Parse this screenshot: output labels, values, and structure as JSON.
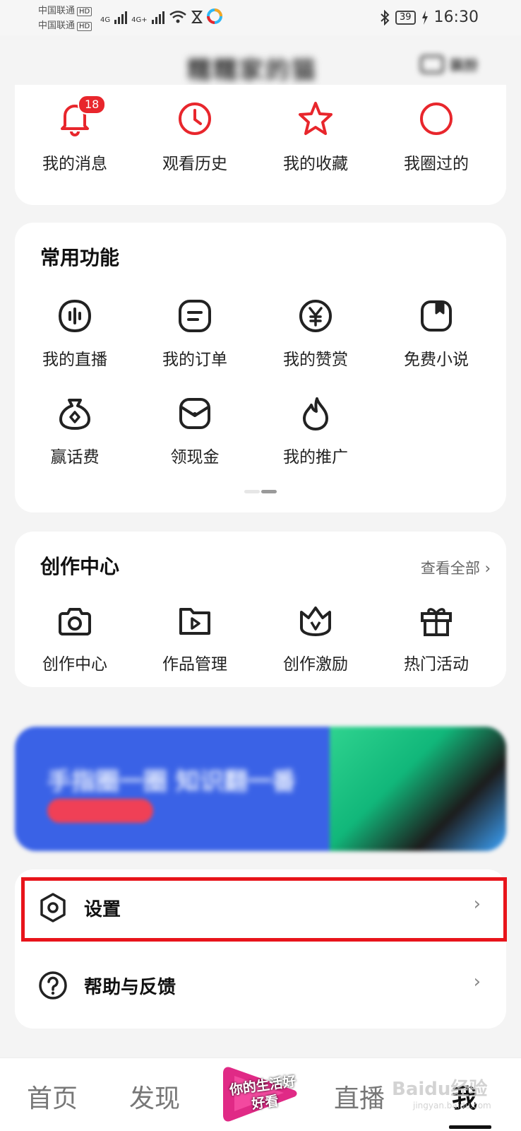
{
  "status_bar": {
    "carrier_1": "中国联通",
    "carrier_2": "中国联通",
    "hd_badge": "HD",
    "network_1": "4G",
    "network_2": "4G+",
    "battery": "39",
    "time": "16:30"
  },
  "header": {
    "username": "糯糯家的猫",
    "button_label": "装扮"
  },
  "quick_access": [
    {
      "label": "我的消息",
      "icon": "bell-icon",
      "badge": "18"
    },
    {
      "label": "观看历史",
      "icon": "clock-icon"
    },
    {
      "label": "我的收藏",
      "icon": "star-icon"
    },
    {
      "label": "我圈过的",
      "icon": "circle-icon"
    }
  ],
  "common_functions": {
    "title": "常用功能",
    "items": [
      {
        "label": "我的直播",
        "icon": "live-icon"
      },
      {
        "label": "我的订单",
        "icon": "order-icon"
      },
      {
        "label": "我的赞赏",
        "icon": "yuan-icon"
      },
      {
        "label": "免费小说",
        "icon": "book-icon"
      },
      {
        "label": "赢话费",
        "icon": "money-bag-icon"
      },
      {
        "label": "领现金",
        "icon": "red-envelope-icon"
      },
      {
        "label": "我的推广",
        "icon": "flame-icon"
      }
    ]
  },
  "creation_center": {
    "title": "创作中心",
    "view_all": "查看全部",
    "items": [
      {
        "label": "创作中心",
        "icon": "camera-icon"
      },
      {
        "label": "作品管理",
        "icon": "video-folder-icon"
      },
      {
        "label": "创作激励",
        "icon": "crown-icon"
      },
      {
        "label": "热门活动",
        "icon": "gift-icon"
      }
    ]
  },
  "banner": {
    "text": "手指圈一圈 知识翻一番"
  },
  "menu": [
    {
      "label": "设置",
      "icon": "settings-icon"
    },
    {
      "label": "帮助与反馈",
      "icon": "help-icon"
    }
  ],
  "tab_bar": {
    "tabs": [
      "首页",
      "发现",
      "直播",
      "我"
    ],
    "center_logo_text": "你的生活好好看",
    "active": "我"
  },
  "watermark": {
    "text": "Baidu经验",
    "url": "jingyan.baidu.com"
  },
  "colors": {
    "accent_red": "#e8262c",
    "highlight_box": "#e8141b",
    "banner_blue": "#3a62e6"
  }
}
